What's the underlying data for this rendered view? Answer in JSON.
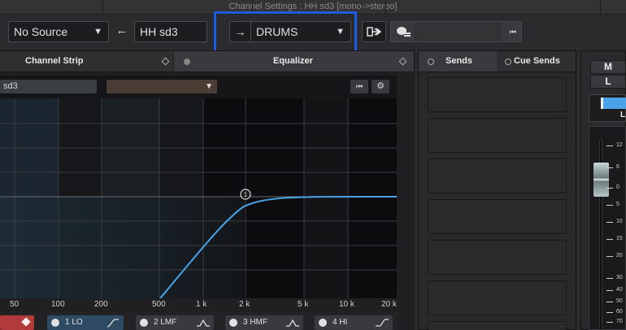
{
  "window": {
    "title": "Channel Settings : HH sd3 [mono->stereo]"
  },
  "toolbar": {
    "source_value": "No Source",
    "channel_name": "HH sd3",
    "output_value": "DRUMS",
    "back_arrow": "←",
    "fwd_arrow": "→",
    "caret": "▼",
    "rewind_glyph": "⏮"
  },
  "tabs": {
    "channel_strip": "Channel Strip",
    "equalizer": "Equalizer",
    "sends": "Sends",
    "cue_sends": "Cue Sends"
  },
  "eq": {
    "preset_name": "sd3",
    "bypass_glyph": "⏮",
    "settings_glyph": "⚙",
    "node_label": "1",
    "x_labels": [
      "50",
      "100",
      "200",
      "500",
      "1 k",
      "2 k",
      "5 k",
      "10 k",
      "20 k"
    ],
    "bands": [
      {
        "label": "1 LO",
        "active": true
      },
      {
        "label": "2 LMF",
        "active": false
      },
      {
        "label": "3 HMF",
        "active": false
      },
      {
        "label": "4 HI",
        "active": false
      }
    ]
  },
  "meter": {
    "m_label": "M",
    "l_label": "L",
    "pan_label": "L",
    "scale": [
      "12",
      "6",
      "0",
      "5",
      "10",
      "15",
      "20",
      "30",
      "40",
      "50",
      "60",
      "70",
      "80"
    ]
  },
  "colors": {
    "accent_blue": "#4aa3e8",
    "highlight": "#1b5de8",
    "red_button": "#b23a3a"
  }
}
